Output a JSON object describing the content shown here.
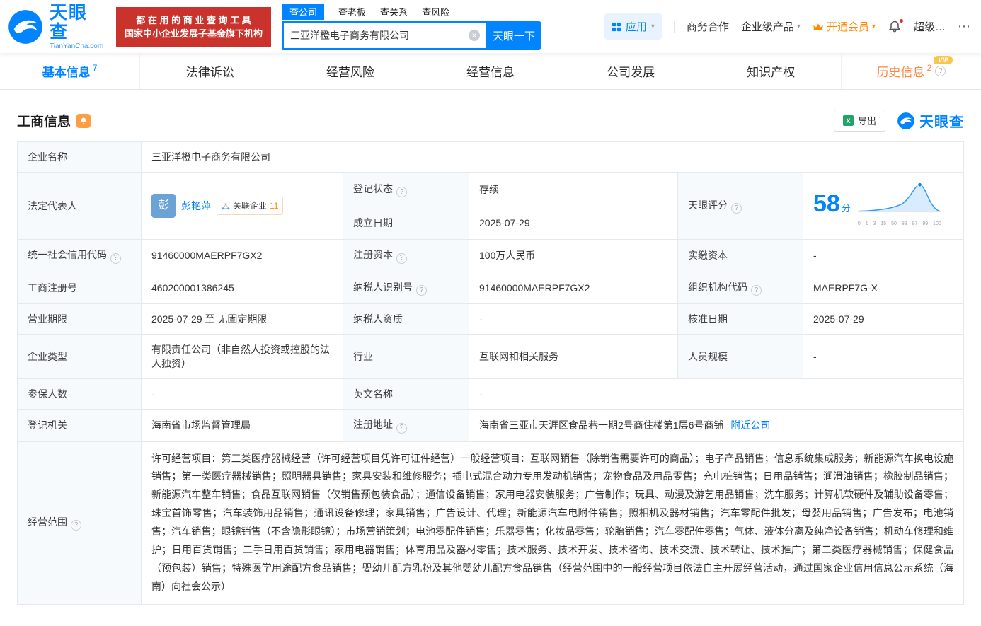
{
  "colors": {
    "primary_blue": "#0084ff",
    "promo_red": "#c9332b",
    "vip_orange": "#ff8a00",
    "status_green": "#00a870",
    "history_orange": "#ff8640"
  },
  "icons": {
    "help": "?",
    "clear": "×",
    "more": "⋯",
    "caret": "▾",
    "excel_letter": "X"
  },
  "brand": {
    "name": "天眼查",
    "domain": "TianYanCha.com"
  },
  "promo": {
    "line1": "都 在 用 的 商 业 查 询 工 具",
    "line2": "国家中小企业发展子基金旗下机构"
  },
  "search": {
    "tabs": [
      {
        "label": "查公司"
      },
      {
        "label": "查老板"
      },
      {
        "label": "查关系"
      },
      {
        "label": "查风险"
      }
    ],
    "value": "三亚洋橙电子商务有限公司",
    "button_label": "天眼一下"
  },
  "topmenu": {
    "apps_label": "应用",
    "cooperation": "商务合作",
    "enterprise": "企业级产品",
    "vip": "开通会员",
    "user": "超级…"
  },
  "nav": {
    "tabs": [
      {
        "label": "基本信息",
        "count": "7"
      },
      {
        "label": "法律诉讼"
      },
      {
        "label": "经营风险"
      },
      {
        "label": "经营信息"
      },
      {
        "label": "公司发展"
      },
      {
        "label": "知识产权"
      },
      {
        "label": "历史信息",
        "count": "2",
        "badge": "VIP"
      }
    ]
  },
  "section": {
    "title": "工商信息",
    "export_label": "导出"
  },
  "info": {
    "company_name": {
      "label": "企业名称",
      "value": "三亚洋橙电子商务有限公司"
    },
    "legal_rep": {
      "label": "法定代表人",
      "avatar": "彭",
      "name": "彭艳萍",
      "related_label": "关联企业",
      "related_count": "11"
    },
    "reg_status": {
      "label": "登记状态",
      "value": "存续"
    },
    "establish_date": {
      "label": "成立日期",
      "value": "2025-07-29"
    },
    "score": {
      "label": "天眼评分",
      "value": "58",
      "unit": "分",
      "axis": [
        "0",
        "1",
        "3",
        "15",
        "50",
        "83",
        "97",
        "99",
        "100"
      ]
    },
    "credit_code": {
      "label": "统一社会信用代码",
      "value": "91460000MAERPF7GX2"
    },
    "reg_capital": {
      "label": "注册资本",
      "value": "100万人民币"
    },
    "paid_capital": {
      "label": "实缴资本",
      "value": "-"
    },
    "reg_number": {
      "label": "工商注册号",
      "value": "460200001386245"
    },
    "taxpayer_id": {
      "label": "纳税人识别号",
      "value": "91460000MAERPF7GX2"
    },
    "org_code": {
      "label": "组织机构代码",
      "value": "MAERPF7G-X"
    },
    "business_term": {
      "label": "营业期限",
      "value": "2025-07-29 至 无固定期限"
    },
    "taxpayer_quality": {
      "label": "纳税人资质",
      "value": "-"
    },
    "approval_date": {
      "label": "核准日期",
      "value": "2025-07-29"
    },
    "company_type": {
      "label": "企业类型",
      "value": "有限责任公司（非自然人投资或控股的法人独资）"
    },
    "industry": {
      "label": "行业",
      "value": "互联网和相关服务"
    },
    "staff_size": {
      "label": "人员规模",
      "value": "-"
    },
    "insured_count": {
      "label": "参保人数",
      "value": "-"
    },
    "english_name": {
      "label": "英文名称",
      "value": "-"
    },
    "reg_authority": {
      "label": "登记机关",
      "value": "海南省市场监督管理局"
    },
    "reg_address": {
      "label": "注册地址",
      "value": "海南省三亚市天涯区食品巷一期2号商住楼第1层6号商铺",
      "link": "附近公司"
    },
    "business_scope": {
      "label": "经营范围",
      "value": "许可经营项目：第三类医疗器械经营（许可经营项目凭许可证件经营）一般经营项目：互联网销售（除销售需要许可的商品）；电子产品销售；信息系统集成服务；新能源汽车换电设施销售；第一类医疗器械销售；照明器具销售；家具安装和维修服务；插电式混合动力专用发动机销售；宠物食品及用品零售；充电桩销售；日用品销售；润滑油销售；橡胶制品销售；新能源汽车整车销售；食品互联网销售（仅销售预包装食品）；通信设备销售；家用电器安装服务；广告制作；玩具、动漫及游艺用品销售；洗车服务；计算机软硬件及辅助设备零售；珠宝首饰零售；汽车装饰用品销售；通讯设备修理；家具销售；广告设计、代理；新能源汽车电附件销售；照相机及器材销售；汽车零配件批发；母婴用品销售；广告发布；电池销售；汽车销售；眼镜销售（不含隐形眼镜）；市场营销策划；电池零配件销售；乐器零售；化妆品零售；轮胎销售；汽车零配件零售；气体、液体分离及纯净设备销售；机动车修理和维护；日用百货销售；二手日用百货销售；家用电器销售；体育用品及器材零售；技术服务、技术开发、技术咨询、技术交流、技术转让、技术推广；第二类医疗器械销售；保健食品（预包装）销售；特殊医学用途配方食品销售；婴幼儿配方乳粉及其他婴幼儿配方食品销售（经营范围中的一般经营项目依法自主开展经营活动，通过国家企业信用信息公示系统（海南）向社会公示）"
    }
  }
}
